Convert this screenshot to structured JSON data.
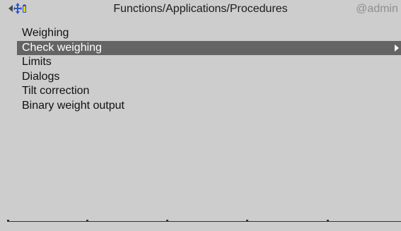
{
  "header": {
    "title": "Functions/Applications/Procedures",
    "user": "@admin",
    "icons": {
      "back": "back-arrow-icon",
      "move": "four-way-arrow-icon",
      "battery": "battery-icon"
    }
  },
  "menu": {
    "items": [
      {
        "label": "Weighing"
      },
      {
        "label": "Check weighing"
      },
      {
        "label": "Limits"
      },
      {
        "label": "Dialogs"
      },
      {
        "label": "Tilt correction"
      },
      {
        "label": "Binary weight output"
      }
    ],
    "selected_index": 1
  },
  "softkeys": [
    "",
    "",
    "",
    "",
    ""
  ],
  "colors": {
    "background": "#cdcdcd",
    "selection": "#646464",
    "icon_blue": "#2d57c8",
    "battery_yellow": "#f0d000",
    "user_text": "#8f8f8f"
  }
}
